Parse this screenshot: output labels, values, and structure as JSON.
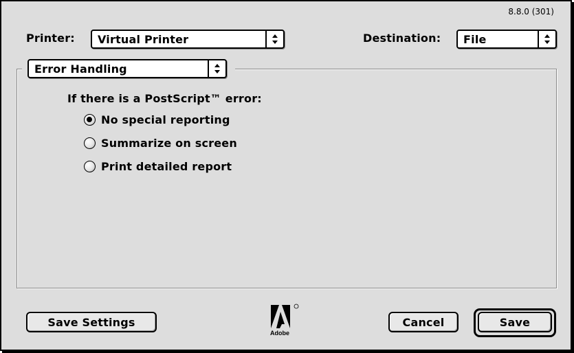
{
  "version": "8.8.0 (301)",
  "printer": {
    "label": "Printer:",
    "value": "Virtual Printer"
  },
  "destination": {
    "label": "Destination:",
    "value": "File"
  },
  "section": {
    "value": "Error Handling"
  },
  "error_group": {
    "heading": "If there is a PostScript™ error:",
    "options": [
      {
        "label": "No special reporting",
        "selected": true
      },
      {
        "label": "Summarize on screen",
        "selected": false
      },
      {
        "label": "Print detailed report",
        "selected": false
      }
    ]
  },
  "buttons": {
    "save_settings": "Save Settings",
    "cancel": "Cancel",
    "save": "Save"
  },
  "logo": {
    "text": "Adobe",
    "icon": "adobe-logo-icon"
  }
}
